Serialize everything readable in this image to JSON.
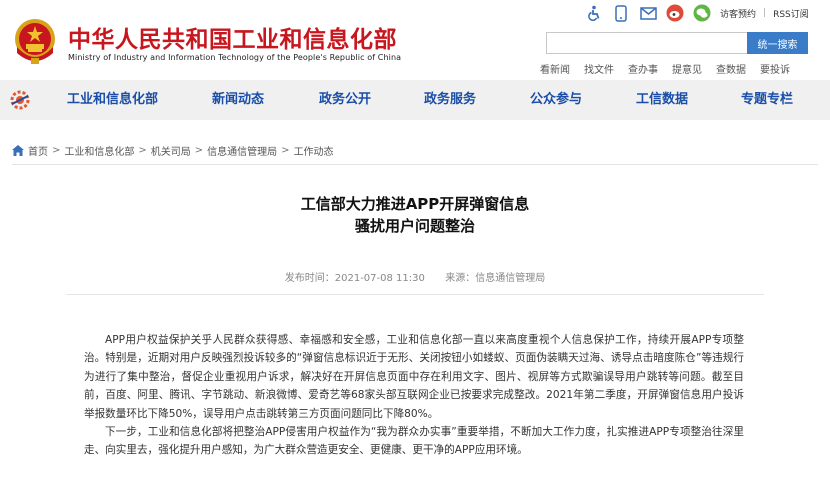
{
  "header": {
    "title": "中华人民共和国工业和信息化部",
    "subtitle": "Ministry of Industry and Information Technology of the People's Republic of China",
    "top_links": {
      "visit": "访客预约",
      "rss": "RSS订阅"
    },
    "icons": [
      "accessibility-icon",
      "mobile-icon",
      "mail-icon",
      "weibo-icon",
      "wechat-icon"
    ],
    "search": {
      "placeholder": "",
      "button": "统一搜索"
    },
    "quick_links": [
      "看新闻",
      "找文件",
      "查办事",
      "提意见",
      "查数据",
      "要投诉"
    ]
  },
  "nav": {
    "items": [
      "工业和信息化部",
      "新闻动态",
      "政务公开",
      "政务服务",
      "公众参与",
      "工信数据",
      "专题专栏"
    ]
  },
  "breadcrumb": [
    "首页",
    "工业和信息化部",
    "机关司局",
    "信息通信管理局",
    "工作动态"
  ],
  "article": {
    "title_line1": "工信部大力推进APP开屏弹窗信息",
    "title_line2": "骚扰用户问题整治",
    "publish": "发布时间：2021-07-08 11:30",
    "source": "来源：信息通信管理局",
    "paragraphs": [
      "APP用户权益保护关乎人民群众获得感、幸福感和安全感，工业和信息化部一直以来高度重视个人信息保护工作，持续开展APP专项整治。特别是，近期对用户反映强烈投诉较多的“弹窗信息标识近于无形、关闭按钮小如蝼蚁、页面伪装瞒天过海、诱导点击暗度陈仓”等违规行为进行了集中整治，督促企业重视用户诉求，解决好在开屏信息页面中存在利用文字、图片、视屏等方式欺骗误导用户跳转等问题。截至目前，百度、阿里、腾讯、字节跳动、新浪微博、爱奇艺等68家头部互联网企业已按要求完成整改。2021年第二季度，开屏弹窗信息用户投诉举报数量环比下降50%，误导用户点击跳转第三方页面问题同比下降80%。",
      "下一步，工业和信息化部将把整治APP侵害用户权益作为“我为群众办实事”重要举措，不断加大工作力度，扎实推进APP专项整治往深里走、向实里去，强化提升用户感知，为广大群众营造更安全、更健康、更干净的APP应用环境。"
    ]
  },
  "colors": {
    "brand_red": "#c8161e",
    "nav_blue": "#1a4ea8",
    "search_blue": "#3a7cc8",
    "nav_bg": "#f0f0f0"
  }
}
